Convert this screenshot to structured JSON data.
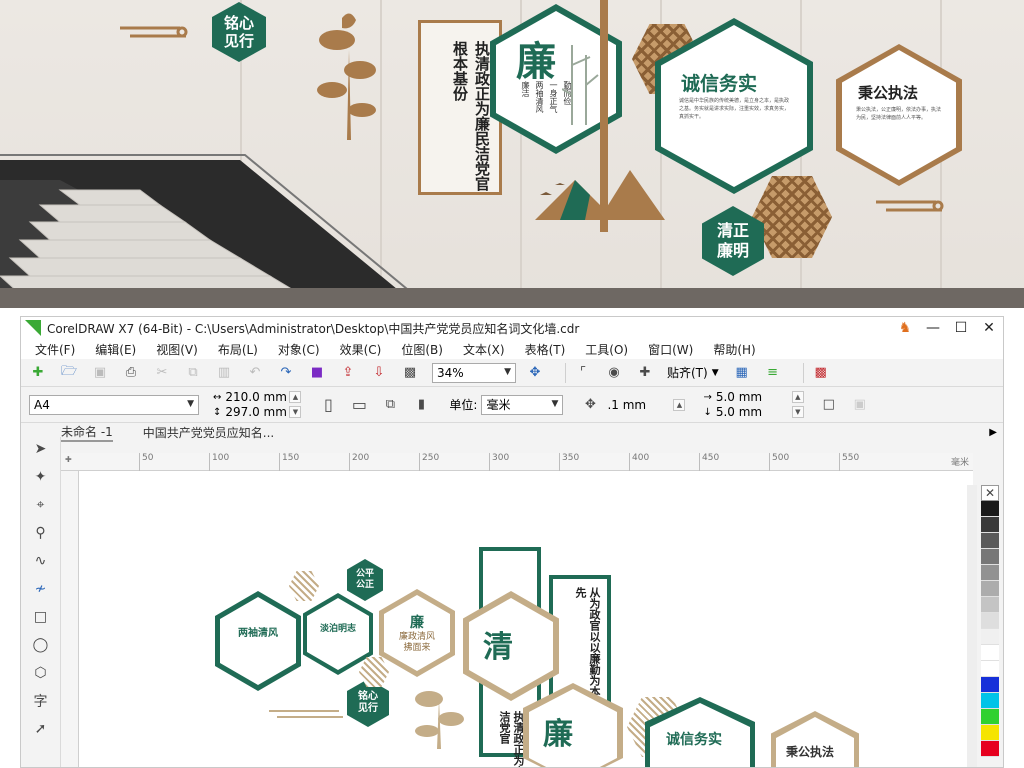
{
  "preview": {
    "hex_mingxin": "铭心见行",
    "main_hex_char": "廉",
    "main_hex_sub": [
      "廉洁",
      "两袖清风",
      "一身正气",
      "勤而俭"
    ],
    "column_text": "执清政正为廉民洁党官根本基份",
    "hex_chengxin": "诚信务实",
    "hex_chengxin_body": "诚信是中华民族的传统美德，是立身之本，是执政之基。务实就是讲求实际，注重实效，求真务实，真抓实干。",
    "hex_binggong": "秉公执法",
    "hex_binggong_body": "秉公执法，公正廉明，依法办事，执法为民，坚持法律面前人人平等。",
    "hex_qingzheng": "清正廉明"
  },
  "window": {
    "title": "CorelDRAW X7 (64-Bit) - C:\\Users\\Administrator\\Desktop\\中国共产党党员应知名词文化墙.cdr",
    "min_icon": "minimize-icon",
    "max_icon": "maximize-icon",
    "close_icon": "close-icon"
  },
  "menu": [
    "文件(F)",
    "编辑(E)",
    "视图(V)",
    "布局(L)",
    "对象(C)",
    "效果(C)",
    "位图(B)",
    "文本(X)",
    "表格(T)",
    "工具(O)",
    "窗口(W)",
    "帮助(H)"
  ],
  "toolbar1": {
    "zoom": "34%",
    "snap_label": "贴齐(T)"
  },
  "toolbar2": {
    "page_size": "A4",
    "width": "210.0 mm",
    "height": "297.0 mm",
    "units_label": "单位:",
    "units": "毫米",
    "nudge": ".1 mm",
    "dup_x": "5.0 mm",
    "dup_y": "5.0 mm"
  },
  "doc_tabs": [
    "未命名 -1",
    "中国共产党党员应知名..."
  ],
  "ruler": {
    "ticks": [
      "50",
      "100",
      "150",
      "200",
      "250",
      "300",
      "350",
      "400",
      "450",
      "500",
      "550"
    ],
    "unit": "毫米"
  },
  "canvas": {
    "hex_liangxiu": "两袖清风",
    "hex_danbo": "淡泊明志",
    "hex_gongping": "公平公正",
    "hex_lian_small": "廉",
    "hex_lian_small_sub": "廉政清风拂面来",
    "hex_mingxin": "铭心见行",
    "hex_qing": "清",
    "column_right": "从为政官以以廉勤为本先",
    "column_left": "执清政正为廉民洁党官",
    "hex_lian_big": "廉",
    "hex_chengxin": "诚信务实",
    "hex_binggong": "秉公执法"
  },
  "palette": [
    "#1a1a1a",
    "#3a3a3a",
    "#5a5a5a",
    "#777777",
    "#929292",
    "#acacac",
    "#c4c4c4",
    "#dedede",
    "#f0f0f0",
    "#ffffff",
    "#ffffff",
    "#1630d9",
    "#00c3e8",
    "#2fd12f",
    "#f5e400",
    "#e6001e"
  ],
  "colors": {
    "accent_green": "#1f6b55",
    "wood": "#a97b4b",
    "corel_green": "#3aa935"
  }
}
